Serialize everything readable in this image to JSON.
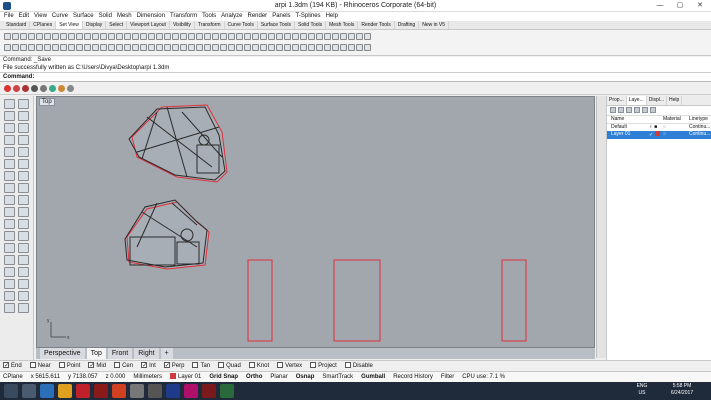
{
  "window": {
    "title": "arpi 1.3dm (194 KB) - Rhinoceros Corporate (64-bit)"
  },
  "menu": [
    "File",
    "Edit",
    "View",
    "Curve",
    "Surface",
    "Solid",
    "Mesh",
    "Dimension",
    "Transform",
    "Tools",
    "Analyze",
    "Render",
    "Panels",
    "T-Splines",
    "Help"
  ],
  "toolbar_tabs": [
    "Standard",
    "CPlanes",
    "Set View",
    "Display",
    "Select",
    "Viewport Layout",
    "Visibility",
    "Transform",
    "Curve Tools",
    "Surface Tools",
    "Solid Tools",
    "Mesh Tools",
    "Render Tools",
    "Drafting",
    "New in V5"
  ],
  "command": {
    "history": [
      "Command: _Save",
      "File successfully written as C:\\Users\\Divya\\Desktop\\arpi 1.3dm"
    ],
    "prompt": "Command:"
  },
  "viewport": {
    "label": "Top",
    "tabs": [
      "Perspective",
      "Top",
      "Front",
      "Right"
    ],
    "active_tab": "Top",
    "axis_x": "x",
    "axis_y": "y"
  },
  "panel": {
    "tabs": [
      "Prop...",
      "Laye...",
      "Displ...",
      "Help"
    ],
    "columns": [
      "Name",
      "Material",
      "Linetype"
    ],
    "layers": [
      {
        "name": "Default",
        "linetype": "Continu..."
      },
      {
        "name": "Layer 01",
        "linetype": "Continu..."
      }
    ]
  },
  "osnaps": [
    {
      "label": "End",
      "checked": true
    },
    {
      "label": "Near",
      "checked": false
    },
    {
      "label": "Point",
      "checked": false
    },
    {
      "label": "Mid",
      "checked": true
    },
    {
      "label": "Cen",
      "checked": false
    },
    {
      "label": "Int",
      "checked": true
    },
    {
      "label": "Perp",
      "checked": true
    },
    {
      "label": "Tan",
      "checked": false
    },
    {
      "label": "Quad",
      "checked": false
    },
    {
      "label": "Knot",
      "checked": false
    },
    {
      "label": "Vertex",
      "checked": false
    },
    {
      "label": "Project",
      "checked": false
    },
    {
      "label": "Disable",
      "checked": false
    }
  ],
  "status": {
    "cplane": "CPlane",
    "x": "x 5615.611",
    "y": "y 7138.057",
    "z": "z 0.000",
    "units": "Millimeters",
    "layer": "Layer 01",
    "buttons": [
      "Grid Snap",
      "Ortho",
      "Planar",
      "Osnap",
      "SmartTrack",
      "Gumball",
      "Record History",
      "Filter"
    ],
    "cpu": "CPU use: 7.1 %"
  },
  "taskbar": {
    "lang": "ENG",
    "region": "US",
    "time": "5:58 PM",
    "date": "6/24/2017"
  },
  "colors": {
    "viewport_bg": "#a2a7ae",
    "selection": "#2f7fd6",
    "layer_swatch": "#d03a3a",
    "geometry": "#2a2a2a",
    "highlight": "#e0303a"
  }
}
